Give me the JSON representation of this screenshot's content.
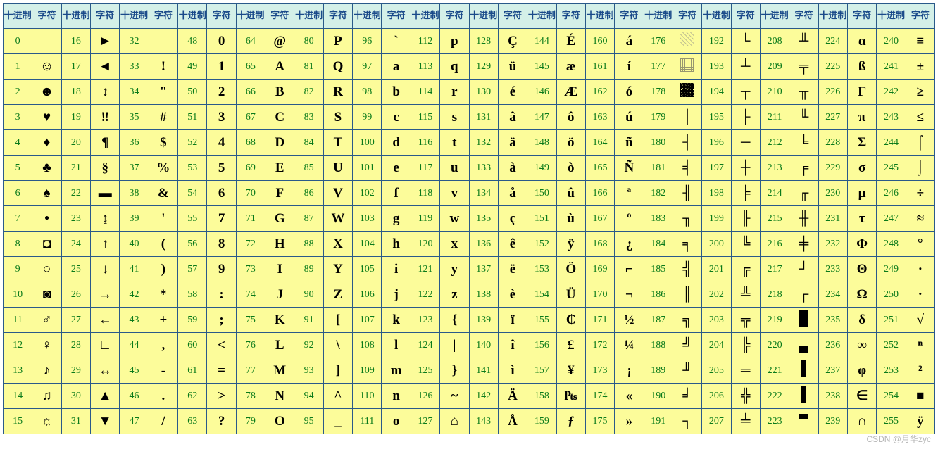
{
  "header_dec": "十进制",
  "header_chr": "字符",
  "watermark": "CSDN @月华zyc",
  "chars": [
    "",
    "☺",
    "☻",
    "♥",
    "♦",
    "♣",
    "♠",
    "•",
    "◘",
    "○",
    "◙",
    "♂",
    "♀",
    "♪",
    "♫",
    "☼",
    "►",
    "◄",
    "↕",
    "‼",
    "¶",
    "§",
    "▬",
    "↨",
    "↑",
    "↓",
    "→",
    "←",
    "∟",
    "↔",
    "▲",
    "▼",
    " ",
    "!",
    "\"",
    "#",
    "$",
    "%",
    "&",
    "'",
    "(",
    ")",
    "*",
    "+",
    ",",
    "-",
    ".",
    "/",
    "0",
    "1",
    "2",
    "3",
    "4",
    "5",
    "6",
    "7",
    "8",
    "9",
    ":",
    ";",
    "<",
    "=",
    ">",
    "?",
    "@",
    "A",
    "B",
    "C",
    "D",
    "E",
    "F",
    "G",
    "H",
    "I",
    "J",
    "K",
    "L",
    "M",
    "N",
    "O",
    "P",
    "Q",
    "R",
    "S",
    "T",
    "U",
    "V",
    "W",
    "X",
    "Y",
    "Z",
    "[",
    "\\",
    "]",
    "^",
    "_",
    "`",
    "a",
    "b",
    "c",
    "d",
    "e",
    "f",
    "g",
    "h",
    "i",
    "j",
    "k",
    "l",
    "m",
    "n",
    "o",
    "p",
    "q",
    "r",
    "s",
    "t",
    "u",
    "v",
    "w",
    "x",
    "y",
    "z",
    "{",
    "|",
    "}",
    "~",
    "⌂",
    "Ç",
    "ü",
    "é",
    "â",
    "ä",
    "à",
    "å",
    "ç",
    "ê",
    "ë",
    "è",
    "ï",
    "î",
    "ì",
    "Ä",
    "Å",
    "É",
    "æ",
    "Æ",
    "ô",
    "ö",
    "ò",
    "û",
    "ù",
    "ÿ",
    "Ö",
    "Ü",
    "₵",
    "£",
    "¥",
    "₧",
    "ƒ",
    "á",
    "í",
    "ó",
    "ú",
    "ñ",
    "Ñ",
    "ª",
    "º",
    "¿",
    "⌐",
    "¬",
    "½",
    "¼",
    "¡",
    "«",
    "»",
    "░",
    "▒",
    "▓",
    "│",
    "┤",
    "╡",
    "╢",
    "╖",
    "╕",
    "╣",
    "║",
    "╗",
    "╝",
    "╜",
    "╛",
    "┐",
    "└",
    "┴",
    "┬",
    "├",
    "─",
    "┼",
    "╞",
    "╟",
    "╚",
    "╔",
    "╩",
    "╦",
    "╠",
    "═",
    "╬",
    "╧",
    "╨",
    "╤",
    "╥",
    "╙",
    "╘",
    "╒",
    "╓",
    "╫",
    "╪",
    "┘",
    "┌",
    "█",
    "▄",
    "▌",
    "▐",
    "▀",
    "α",
    "ß",
    "Γ",
    "π",
    "Σ",
    "σ",
    "µ",
    "τ",
    "Φ",
    "Θ",
    "Ω",
    "δ",
    "∞",
    "φ",
    "∈",
    "∩",
    "≡",
    "±",
    "≥",
    "≤",
    "⌠",
    "⌡",
    "÷",
    "≈",
    "°",
    "∙",
    "·",
    "√",
    "ⁿ",
    "²",
    "■",
    "ÿ"
  ]
}
